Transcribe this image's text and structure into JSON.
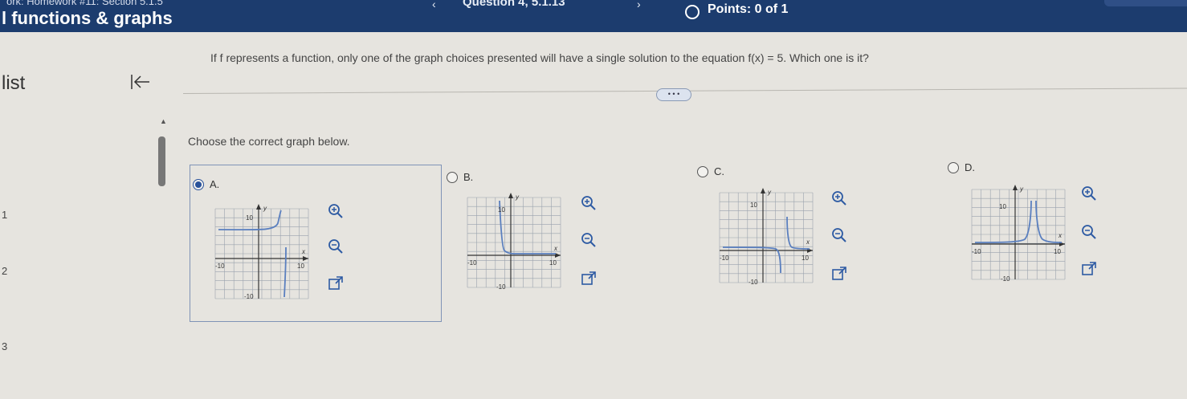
{
  "header": {
    "homework_title": "ork: Homework #11: Section 5.1.5",
    "section_title": "l functions & graphs",
    "prev_icon": "chevron-left-icon",
    "prev_glyph": "‹",
    "question_label": "Question 4, 5.1.13",
    "next_icon": "chevron-right-icon",
    "next_glyph": "›",
    "points_label": "Points: 0 of 1",
    "bar_color": "#1c3c6e"
  },
  "sidebar": {
    "list_label": "list",
    "collapse_icon": "collapse-left-icon",
    "scroll_up_glyph": "▲",
    "row_numbers": [
      "1",
      "2",
      "3"
    ]
  },
  "main": {
    "question_text": "If f represents a function, only one of the graph choices presented will have a single solution to the equation f(x) = 5. Which one is it?",
    "more_label": "• • •",
    "instruction": "Choose the correct graph below.",
    "selected_choice": "A",
    "choices": [
      {
        "letter": "A.",
        "selected": true,
        "graph": {
          "y_label": "y",
          "x_label": "x",
          "y_max_label": "10",
          "y_min_label": "-10",
          "x_min_label": "-10",
          "x_max_label": "10"
        }
      },
      {
        "letter": "B.",
        "selected": false,
        "graph": {
          "y_label": "y",
          "x_label": "x",
          "y_max_label": "10",
          "y_min_label": "-10",
          "x_min_label": "-10",
          "x_max_label": "10"
        }
      },
      {
        "letter": "C.",
        "selected": false,
        "graph": {
          "y_label": "y",
          "x_label": "x",
          "y_max_label": "10",
          "y_min_label": "-10",
          "x_min_label": "-10",
          "x_max_label": "10"
        }
      },
      {
        "letter": "D.",
        "selected": false,
        "graph": {
          "y_label": "y",
          "x_label": "x",
          "y_max_label": "10",
          "y_min_label": "-10",
          "x_min_label": "-10",
          "x_max_label": "10"
        }
      }
    ],
    "graph_tools": [
      "zoom-in-icon",
      "zoom-out-icon",
      "open-new-window-icon"
    ],
    "accent_color": "#29529a"
  }
}
